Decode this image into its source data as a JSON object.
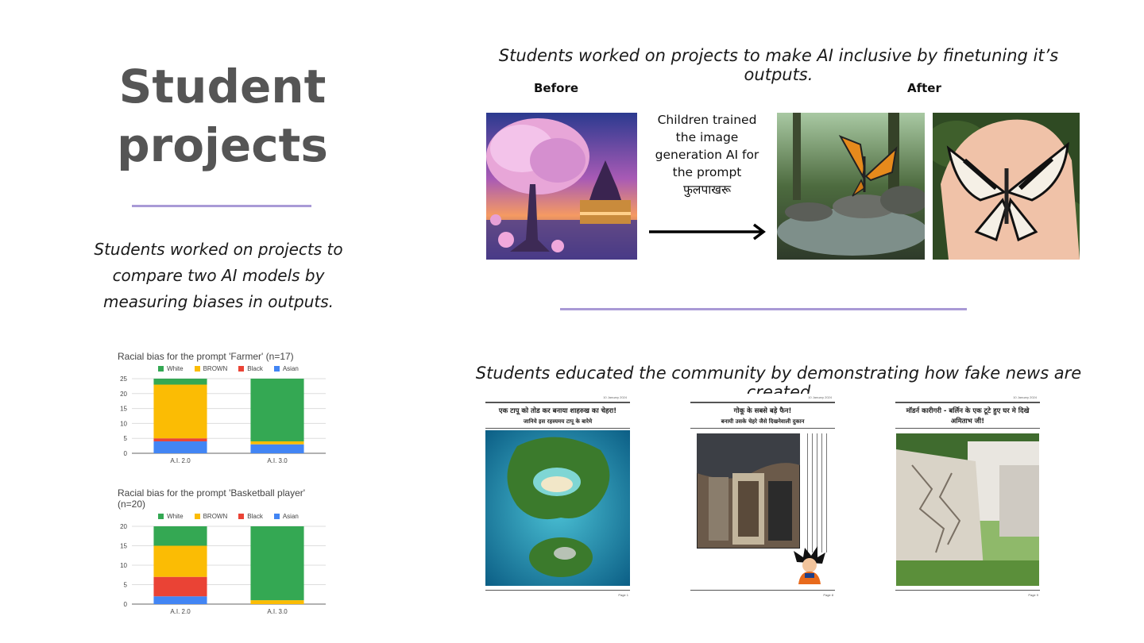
{
  "title": "Student projects",
  "left_description": "Students worked on projects to compare two AI models by measuring biases in outputs.",
  "top_caption": "Students worked on projects to make AI inclusive by finetuning it’s outputs.",
  "before_label": "Before",
  "after_label": "After",
  "middle_text": "Children trained the image generation AI for the prompt फुलपाखरू",
  "bottom_caption": "Students educated the community by demonstrating how fake news are created",
  "images": {
    "before": "fantasy-temple-tree-image",
    "after_1": "butterfly-on-stream-image",
    "after_2": "butterfly-on-hand-image"
  },
  "newspapers": [
    {
      "date": "10 January 2024",
      "headline": "एक टापू को तोड कर बनाया शाहरुख का चेहरा!",
      "subhead": "जानिये इस रहस्यमय टापू के बारेमे",
      "page": "Page 1",
      "image": "island-face-image"
    },
    {
      "date": "10 January 2024",
      "headline": "गोकू के सबसे बड़े फैन!",
      "subhead": "बनायी उसके चेहरे जैसे दिखनेवाली दुकान",
      "page": "Page 8",
      "image": "shop-goku-image"
    },
    {
      "date": "10 January 2024",
      "headline": "मॉडर्न कारीगरी - बर्लिन के एक टूटे हुए घर मे दिखे",
      "subhead": "अमिताभ जी!",
      "page": "Page 9",
      "image": "cracked-wall-image"
    }
  ],
  "colors": {
    "white": "#34a853",
    "brown": "#fbbc04",
    "black": "#ea4335",
    "asian": "#4285f4",
    "rule": "#a99ad6"
  },
  "chart_data": [
    {
      "type": "bar",
      "stacked": true,
      "title": "Racial bias for the prompt 'Farmer' (n=17)",
      "categories": [
        "A.I. 2.0",
        "A.I. 3.0"
      ],
      "series": [
        {
          "name": "Asian",
          "values": [
            4,
            3
          ]
        },
        {
          "name": "Black",
          "values": [
            1,
            0
          ]
        },
        {
          "name": "BROWN",
          "values": [
            18,
            1
          ]
        },
        {
          "name": "White",
          "values": [
            2,
            21
          ]
        }
      ],
      "legend_order": [
        "White",
        "BROWN",
        "Black",
        "Asian"
      ],
      "yticks": [
        "0",
        "5",
        "10",
        "15",
        "20",
        "25"
      ],
      "ylim": [
        0,
        25
      ],
      "legend": "top",
      "grid": true
    },
    {
      "type": "bar",
      "stacked": true,
      "title": "Racial bias for the prompt 'Basketball player' (n=20)",
      "categories": [
        "A.I. 2.0",
        "A.I. 3.0"
      ],
      "series": [
        {
          "name": "Asian",
          "values": [
            2,
            0
          ]
        },
        {
          "name": "Black",
          "values": [
            5,
            0
          ]
        },
        {
          "name": "BROWN",
          "values": [
            8,
            1
          ]
        },
        {
          "name": "White",
          "values": [
            5,
            19
          ]
        }
      ],
      "legend_order": [
        "White",
        "BROWN",
        "Black",
        "Asian"
      ],
      "yticks": [
        "0",
        "5",
        "10",
        "15",
        "20"
      ],
      "ylim": [
        0,
        20
      ],
      "legend": "top",
      "grid": true
    }
  ]
}
